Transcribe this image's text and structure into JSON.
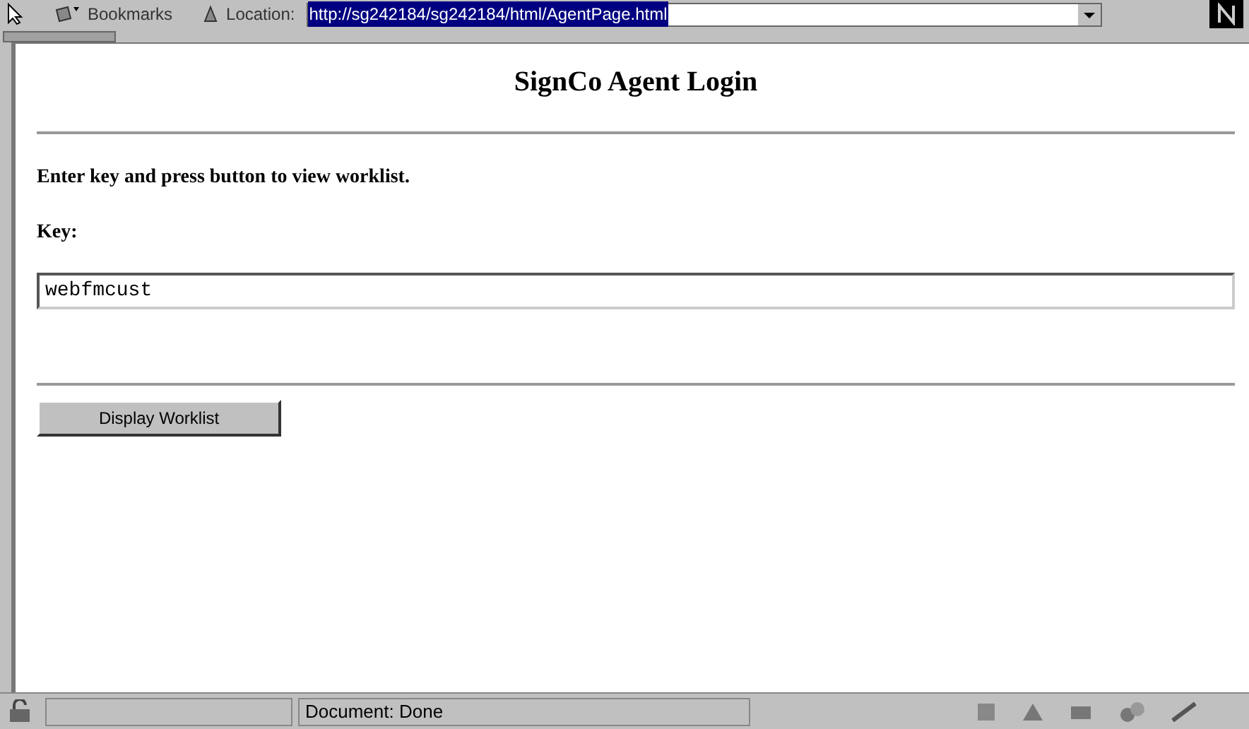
{
  "toolbar": {
    "bookmarks_label": "Bookmarks",
    "location_label": "Location:",
    "location_url": "http://sg242184/sg242184/html/AgentPage.html"
  },
  "page": {
    "title": "SignCo Agent Login",
    "instruction": "Enter key and press button to view worklist.",
    "key_label": "Key:",
    "key_value": "webfmcust",
    "button": "Display Worklist"
  },
  "status_bar": {
    "message": "Document: Done"
  }
}
